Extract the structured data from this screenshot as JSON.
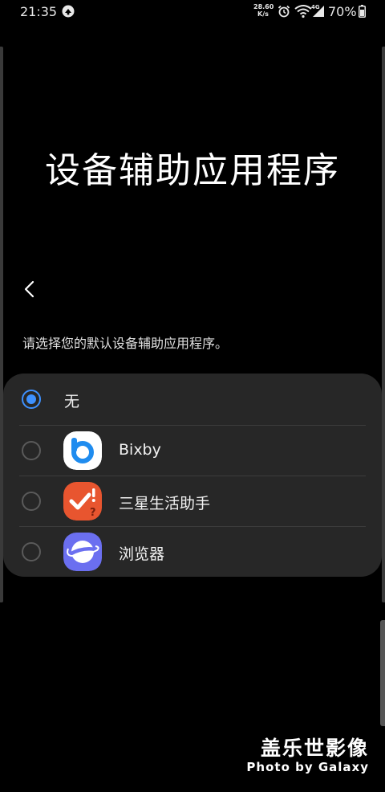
{
  "status_bar": {
    "time": "21:35",
    "net_speed_value": "28.60",
    "net_speed_unit": "K/s",
    "battery_text": "70%"
  },
  "header": {
    "title": "设备辅助应用程序"
  },
  "subtitle": "请选择您的默认设备辅助应用程序。",
  "options": [
    {
      "label": "无",
      "selected": true
    },
    {
      "label": "Bixby",
      "selected": false,
      "icon": "bixby-icon"
    },
    {
      "label": "三星生活助手",
      "selected": false,
      "icon": "samsung-life-assistant-icon"
    },
    {
      "label": "浏览器",
      "selected": false,
      "icon": "browser-icon"
    }
  ],
  "watermark": {
    "title": "盖乐世影像",
    "subtitle": "Photo by Galaxy"
  },
  "colors": {
    "accent": "#3e91ff",
    "card_background": "#272727",
    "background": "#000000"
  }
}
